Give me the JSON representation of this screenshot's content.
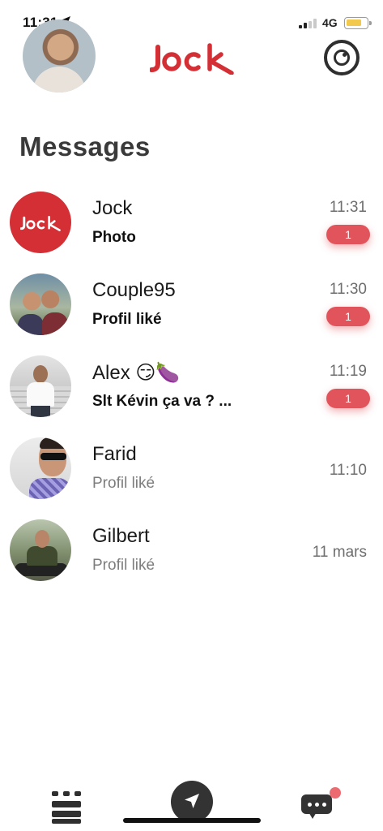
{
  "status_bar": {
    "time": "11:31",
    "network": "4G",
    "colors": {
      "battery": "#f2c94c"
    }
  },
  "header": {
    "logo_text": "jock",
    "logo_color": "#d32f35"
  },
  "page_title": "Messages",
  "conversations": [
    {
      "name": "Jock",
      "preview": "Photo",
      "time": "11:31",
      "badge": "1",
      "unread": true
    },
    {
      "name": "Couple95",
      "preview": "Profil liké",
      "time": "11:30",
      "badge": "1",
      "unread": true
    },
    {
      "name": "Alex 😏🍆",
      "preview": "Slt Kévin ça va ? ...",
      "time": "11:19",
      "badge": "1",
      "unread": true
    },
    {
      "name": "Farid",
      "preview": "Profil liké",
      "time": "11:10",
      "unread": false
    },
    {
      "name": "Gilbert",
      "preview": "Profil liké",
      "time": "11 mars",
      "unread": false
    }
  ],
  "colors": {
    "badge": "#e2545b",
    "brand": "#d32f35",
    "notification_dot": "#ec6b71"
  },
  "tabbar": {
    "items": [
      {
        "icon": "grid-icon"
      },
      {
        "icon": "navigation-arrow-icon"
      },
      {
        "icon": "chat-bubble-icon"
      }
    ]
  }
}
